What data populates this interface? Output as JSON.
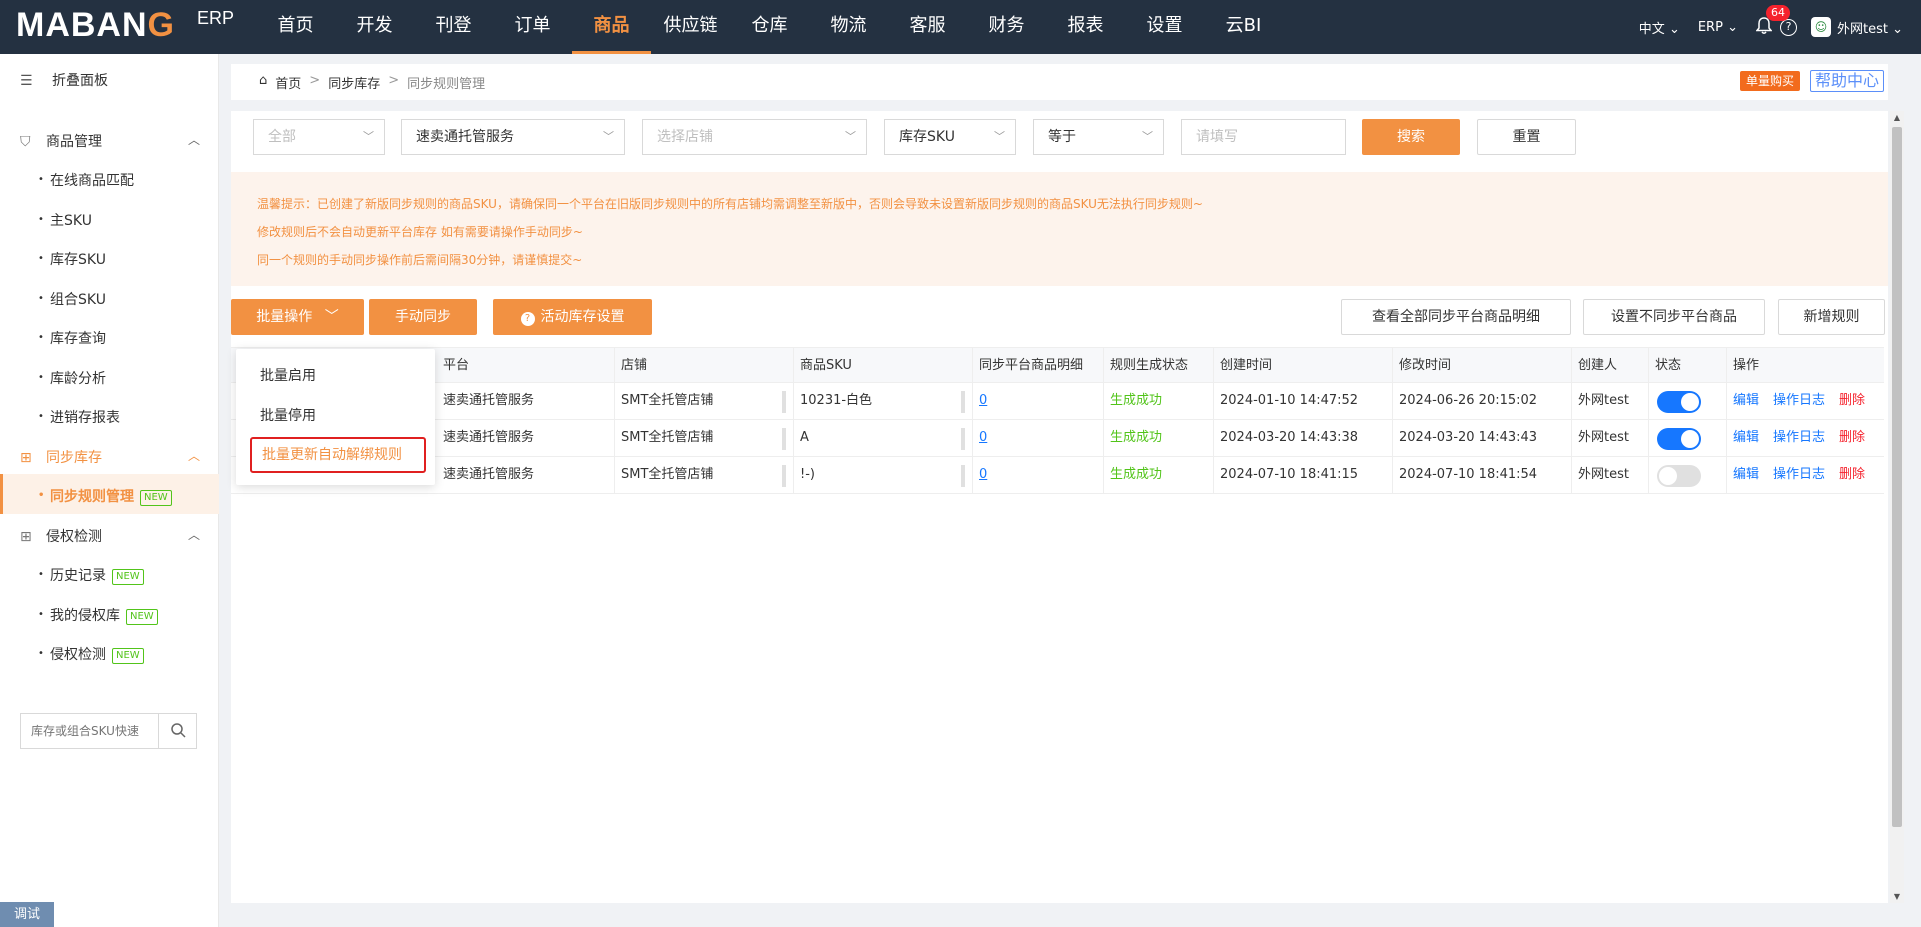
{
  "topbar": {
    "logo_main": "MABAN",
    "logo_g": "G",
    "logo_erp": "ERP",
    "nav": [
      "首页",
      "开发",
      "刊登",
      "订单",
      "商品",
      "供应链",
      "仓库",
      "物流",
      "客服",
      "财务",
      "报表",
      "设置",
      "云BI"
    ],
    "active_nav_index": 4,
    "language": "中文",
    "system": "ERP",
    "notification_count": "64",
    "help_symbol": "?",
    "username": "外网test"
  },
  "sidebar": {
    "fold_label": "折叠面板",
    "groups": [
      {
        "label": "商品管理",
        "items": [
          "在线商品匹配",
          "主SKU",
          "库存SKU",
          "组合SKU",
          "库存查询",
          "库龄分析",
          "进销存报表"
        ]
      },
      {
        "label": "同步库存",
        "items": [
          "同步规则管理"
        ]
      },
      {
        "label": "侵权检测",
        "items": [
          "历史记录",
          "我的侵权库",
          "侵权检测"
        ]
      }
    ],
    "new_tag": "NEW",
    "search_placeholder": "库存或组合SKU快速",
    "debug_label": "调试"
  },
  "breadcrumb": {
    "home": "首页",
    "level1": "同步库存",
    "current": "同步规则管理",
    "single_buy": "单量购买",
    "help_center": "帮助中心"
  },
  "filters": {
    "select1": "全部",
    "select2": "速卖通托管服务",
    "select3": "选择店铺",
    "select4": "库存SKU",
    "select5": "等于",
    "input_placeholder": "请填写",
    "search_btn": "搜索",
    "reset_btn": "重置"
  },
  "notice": {
    "line1": "温馨提示：已创建了新版同步规则的商品SKU，请确保同一个平台在旧版同步规则中的所有店铺均需调整至新版中，否则会导致未设置新版同步规则的商品SKU无法执行同步规则~",
    "line2": "修改规则后不会自动更新平台库存 如有需要请操作手动同步~",
    "line3": "同一个规则的手动同步操作前后需间隔30分钟，请谨慎提交~"
  },
  "actions": {
    "batch": "批量操作",
    "manual_sync": "手动同步",
    "activity_stock": "活动库存设置",
    "view_all": "查看全部同步平台商品明细",
    "set_no_sync": "设置不同步平台商品",
    "add_rule": "新增规则"
  },
  "dropdown": {
    "items": [
      "批量启用",
      "批量停用",
      "批量更新自动解绑规则"
    ]
  },
  "table": {
    "headers": [
      "平台",
      "店铺",
      "商品SKU",
      "同步平台商品明细",
      "规则生成状态",
      "创建时间",
      "修改时间",
      "创建人",
      "状态",
      "操作"
    ],
    "rows": [
      {
        "platform": "速卖通托管服务",
        "shop": "SMT全托管店铺",
        "sku": "10231-白色",
        "detail": "0",
        "status": "生成成功",
        "created": "2024-01-10 14:47:52",
        "modified": "2024-06-26 20:15:02",
        "creator": "外网test",
        "enabled": true
      },
      {
        "platform": "速卖通托管服务",
        "shop": "SMT全托管店铺",
        "sku": "A",
        "detail": "0",
        "status": "生成成功",
        "created": "2024-03-20 14:43:38",
        "modified": "2024-03-20 14:43:43",
        "creator": "外网test",
        "enabled": true
      },
      {
        "platform": "速卖通托管服务",
        "shop": "SMT全托管店铺",
        "sku": "!-)",
        "detail": "0",
        "status": "生成成功",
        "created": "2024-07-10 18:41:15",
        "modified": "2024-07-10 18:41:54",
        "creator": "外网test",
        "enabled": false
      }
    ],
    "ops": {
      "edit": "编辑",
      "log": "操作日志",
      "delete": "删除"
    }
  }
}
